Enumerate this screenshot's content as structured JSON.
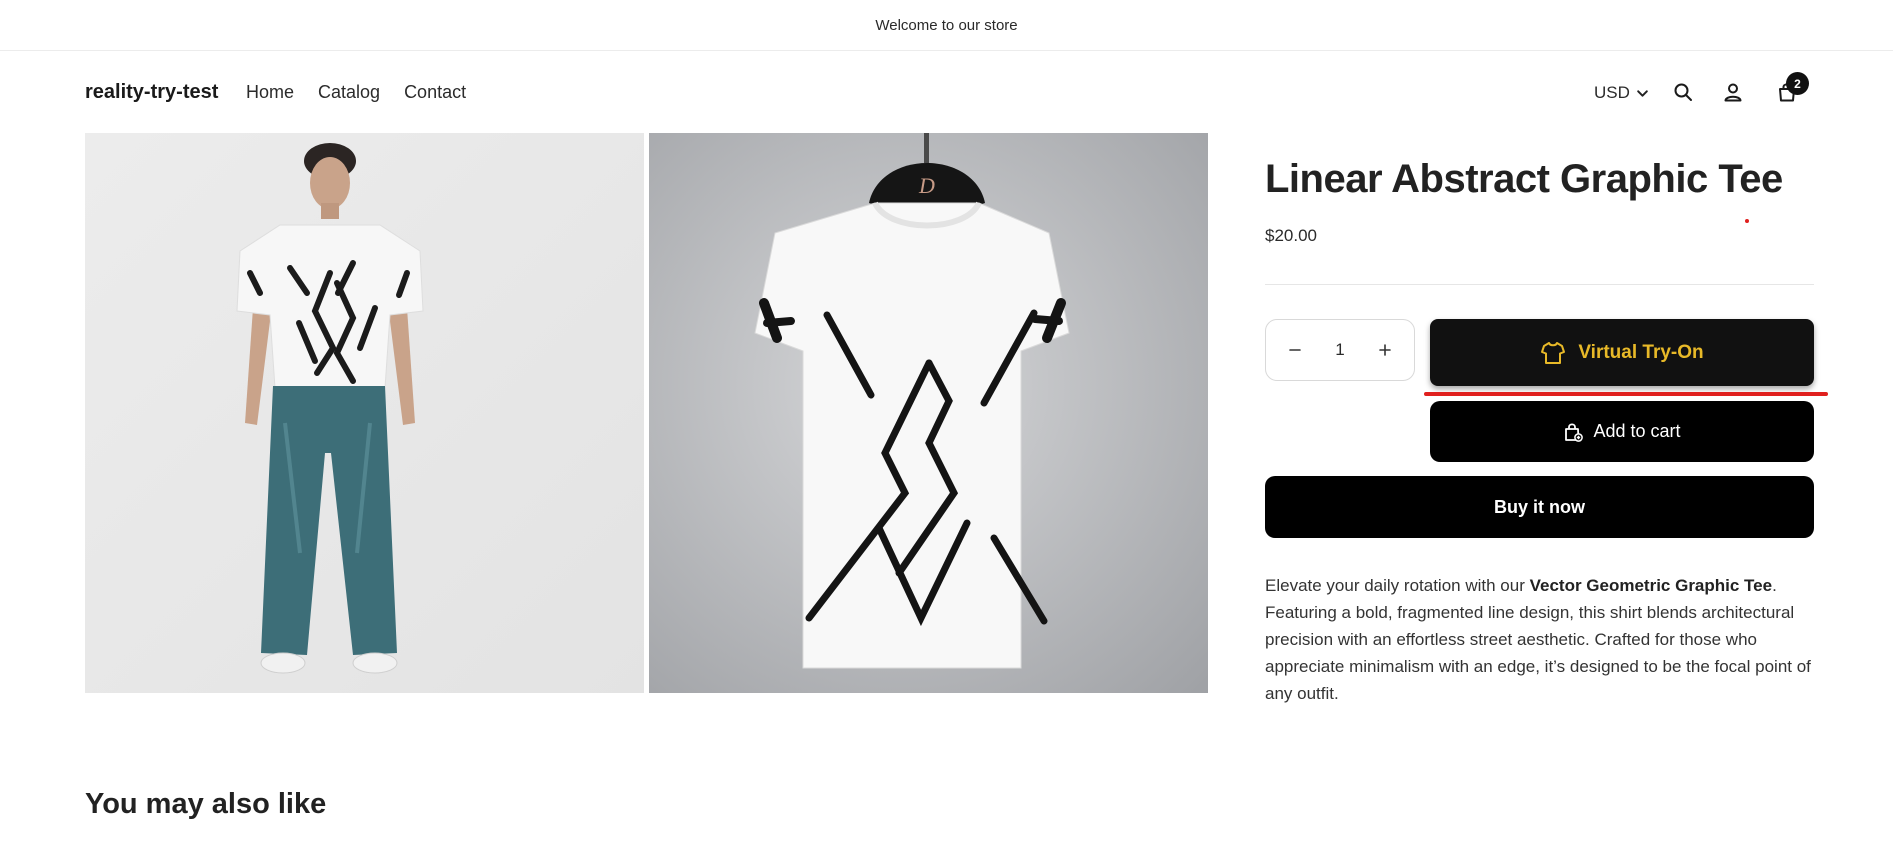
{
  "announcement": {
    "text": "Welcome to our store"
  },
  "header": {
    "logo": "reality-try-test",
    "nav": [
      "Home",
      "Catalog",
      "Contact"
    ],
    "currency": "USD",
    "cart_count": "2",
    "icons": [
      "search-icon",
      "account-icon",
      "cart-icon"
    ]
  },
  "product": {
    "title": "Linear Abstract Graphic Tee",
    "price": "$20.00",
    "quantity": "1",
    "virtual_tryon_label": "Virtual Try-On",
    "add_to_cart_label": "Add to cart",
    "buy_now_label": "Buy it now",
    "description": {
      "prefix": "Elevate your daily rotation with our ",
      "highlight": "Vector Geometric Graphic Tee",
      "suffix": ". Featuring a bold, fragmented line design, this shirt blends architectural precision with an effortless street aesthetic. Crafted for those who appreciate minimalism with an edge, it’s designed to be the focal point of any outfit."
    }
  },
  "recommendations": {
    "heading": "You may also like"
  },
  "colors": {
    "accent_gold": "#e8b928",
    "annotation_red": "#e0201e",
    "button_black": "#000000"
  }
}
